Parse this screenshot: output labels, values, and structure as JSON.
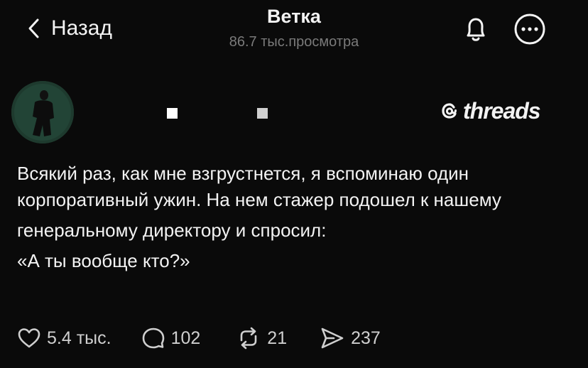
{
  "header": {
    "back_label": "Назад",
    "title": "Ветка",
    "views": "86.7 тыс.просмотра"
  },
  "brand": {
    "name": "threads"
  },
  "post": {
    "lines": [
      "Всякий раз, как мне взгрустнется, я вспоминаю один корпоративный ужин. На нем стажер подошел к нашему",
      "генеральному директору и спросил:",
      "«А ты вообще кто?»"
    ]
  },
  "stats": {
    "likes": "5.4 тыс.",
    "comments": "102",
    "reposts": "21",
    "shares": "237"
  },
  "icons": {
    "back": "chevron-left-icon",
    "bell": "bell-icon",
    "more": "more-horizontal-icon",
    "like": "heart-icon",
    "comment": "comment-icon",
    "repost": "repost-icon",
    "share": "send-icon"
  },
  "colors": {
    "background": "#0a0a0a",
    "text": "#f3f3f3",
    "muted": "#7a7a7a"
  }
}
